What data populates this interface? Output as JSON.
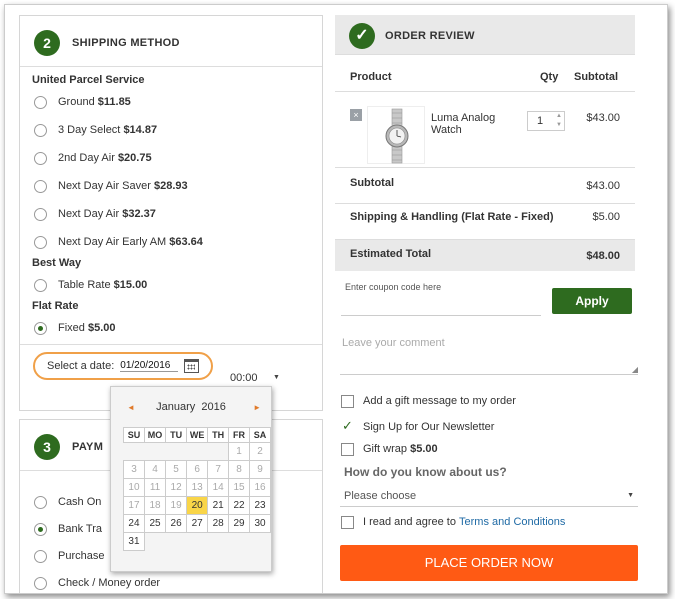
{
  "shipping": {
    "step": "2",
    "title": "SHIPPING METHOD",
    "groups": [
      {
        "title": "United Parcel Service",
        "options": [
          {
            "name": "Ground",
            "price": "$11.85",
            "checked": false
          },
          {
            "name": "3 Day Select",
            "price": "$14.87",
            "checked": false
          },
          {
            "name": "2nd Day Air",
            "price": "$20.75",
            "checked": false
          },
          {
            "name": "Next Day Air Saver",
            "price": "$28.93",
            "checked": false
          },
          {
            "name": "Next Day Air",
            "price": "$32.37",
            "checked": false
          },
          {
            "name": "Next Day Air Early AM",
            "price": "$63.64",
            "checked": false
          }
        ]
      },
      {
        "title": "Best Way",
        "options": [
          {
            "name": "Table Rate",
            "price": "$15.00",
            "checked": false
          }
        ]
      },
      {
        "title": "Flat Rate",
        "options": [
          {
            "name": "Fixed",
            "price": "$5.00",
            "checked": true
          }
        ]
      }
    ],
    "date_label": "Select a date:",
    "date_value": "01/20/2016",
    "time_value": "00:00"
  },
  "datepicker": {
    "month": "January",
    "year": "2016",
    "prev": "◄",
    "next": "►",
    "weekdays": [
      "SU",
      "MO",
      "TU",
      "WE",
      "TH",
      "FR",
      "SA"
    ],
    "weeks": [
      [
        "",
        "",
        "",
        "",
        "",
        "1",
        "2"
      ],
      [
        "3",
        "4",
        "5",
        "6",
        "7",
        "8",
        "9"
      ],
      [
        "10",
        "11",
        "12",
        "13",
        "14",
        "15",
        "16"
      ],
      [
        "17",
        "18",
        "19",
        "20",
        "21",
        "22",
        "23"
      ],
      [
        "24",
        "25",
        "26",
        "27",
        "28",
        "29",
        "30"
      ],
      [
        "31",
        "",
        "",
        "",
        "",
        "",
        ""
      ]
    ],
    "today": "20",
    "first_enabled": "20"
  },
  "payment": {
    "step": "3",
    "title": "PAYM",
    "options": [
      {
        "label": "Cash On",
        "checked": false
      },
      {
        "label": "Bank Tra",
        "checked": true
      },
      {
        "label": "Purchase",
        "checked": false
      },
      {
        "label": "Check / Money order",
        "checked": false
      }
    ]
  },
  "review": {
    "title": "ORDER REVIEW",
    "col_product": "Product",
    "col_qty": "Qty",
    "col_subtotal": "Subtotal",
    "remove": "×",
    "product_name": "Luma Analog Watch",
    "qty": "1",
    "item_subtotal": "$43.00",
    "subtotal_label": "Subtotal",
    "subtotal_value": "$43.00",
    "shipping_label": "Shipping & Handling (Flat Rate - Fixed)",
    "shipping_value": "$5.00",
    "total_label": "Estimated Total",
    "total_value": "$48.00"
  },
  "coupon": {
    "placeholder": "Enter coupon code here",
    "apply": "Apply"
  },
  "comment": {
    "placeholder": "Leave your comment"
  },
  "extras": {
    "gift_message": "Add a gift message to my order",
    "newsletter": "Sign Up for Our Newsletter",
    "gift_wrap": "Gift wrap",
    "gift_wrap_price": "$5.00",
    "how_title": "How do you know about us?",
    "how_select": "Please choose",
    "terms_prefix": "I read and agree to",
    "terms_link": "Terms and Conditions"
  },
  "place_order": "PLACE ORDER NOW",
  "colors": {
    "accent_green": "#2e6b1f",
    "place_order": "#ff5a14",
    "highlight_ring": "#f0a048",
    "today": "#f9d548"
  }
}
